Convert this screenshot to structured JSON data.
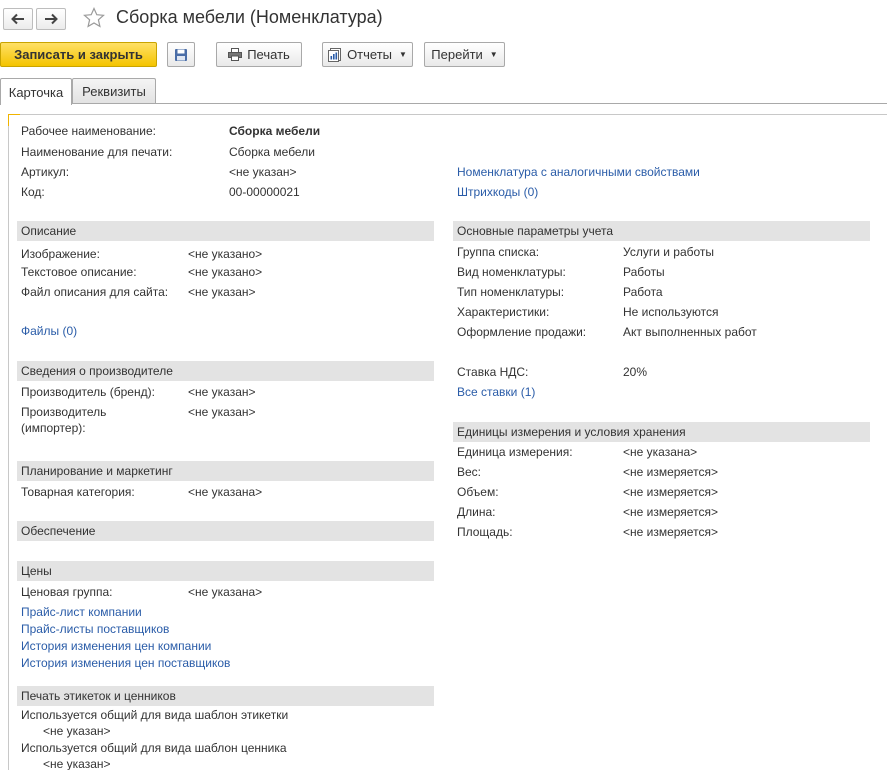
{
  "window": {
    "title": "Сборка мебели (Номенклатура)"
  },
  "toolbar": {
    "save_close": "Записать и закрыть",
    "print": "Печать",
    "reports": "Отчеты",
    "goto": "Перейти"
  },
  "tabs": [
    {
      "label": "Карточка",
      "active": true
    },
    {
      "label": "Реквизиты",
      "active": false
    }
  ],
  "header": {
    "work_name_label": "Рабочее наименование:",
    "work_name_value": "Сборка мебели",
    "print_name_label": "Наименование для печати:",
    "print_name_value": "Сборка мебели",
    "article_label": "Артикул:",
    "article_value": "<не указан>",
    "code_label": "Код:",
    "code_value": "00-00000021",
    "similar_link": "Номенклатура с аналогичными свойствами",
    "barcodes_link": "Штрихкоды (0)"
  },
  "description": {
    "title": "Описание",
    "image_label": "Изображение:",
    "image_value": "<не указано>",
    "text_label": "Текстовое описание:",
    "text_value": "<не указано>",
    "file_label": "Файл описания для сайта:",
    "file_value": "<не указан>",
    "files_link": "Файлы (0)"
  },
  "manufacturer": {
    "title": "Сведения о производителе",
    "brand_label": "Производитель (бренд):",
    "brand_value": "<не указан>",
    "importer_label_1": "Производитель",
    "importer_label_2": "(импортер):",
    "importer_value": "<не указан>"
  },
  "planning": {
    "title": "Планирование и маркетинг",
    "category_label": "Товарная категория:",
    "category_value": "<не указана>"
  },
  "supply": {
    "title": "Обеспечение"
  },
  "prices": {
    "title": "Цены",
    "group_label": "Ценовая группа:",
    "group_value": "<не указана>",
    "links": [
      "Прайс-лист компании",
      "Прайс-листы поставщиков",
      "История изменения цен компании",
      "История изменения цен поставщиков"
    ]
  },
  "labels_print": {
    "title": "Печать этикеток и ценников",
    "label_template_text": "Используется общий для вида шаблон этикетки",
    "label_template_value": "<не указан>",
    "price_tag_template_text": "Используется общий для вида шаблон ценника",
    "price_tag_template_value": "<не указан>"
  },
  "accounting": {
    "title": "Основные параметры учета",
    "rows": [
      {
        "label": "Группа списка:",
        "value": "Услуги и работы"
      },
      {
        "label": "Вид номенклатуры:",
        "value": "Работы"
      },
      {
        "label": "Тип номенклатуры:",
        "value": "Работа"
      },
      {
        "label": "Характеристики:",
        "value": "Не используются"
      },
      {
        "label": "Оформление продажи:",
        "value": "Акт выполненных работ"
      }
    ],
    "vat_label": "Ставка НДС:",
    "vat_value": "20%",
    "all_rates_link": "Все ставки (1)"
  },
  "units": {
    "title": "Единицы измерения и условия хранения",
    "rows": [
      {
        "label": "Единица измерения:",
        "value": "<не указана>"
      },
      {
        "label": "Вес:",
        "value": "<не измеряется>"
      },
      {
        "label": "Объем:",
        "value": "<не измеряется>"
      },
      {
        "label": "Длина:",
        "value": "<не измеряется>"
      },
      {
        "label": "Площадь:",
        "value": "<не измеряется>"
      }
    ]
  },
  "icons": {
    "back": "arrow-left-icon",
    "forward": "arrow-right-icon",
    "favorite": "star-icon",
    "save": "floppy-disk-icon",
    "print": "printer-icon",
    "reports": "report-icon",
    "accent_color": "#f4c400",
    "link_color": "#2a5ca8",
    "section_bg": "#e3e3e3"
  }
}
